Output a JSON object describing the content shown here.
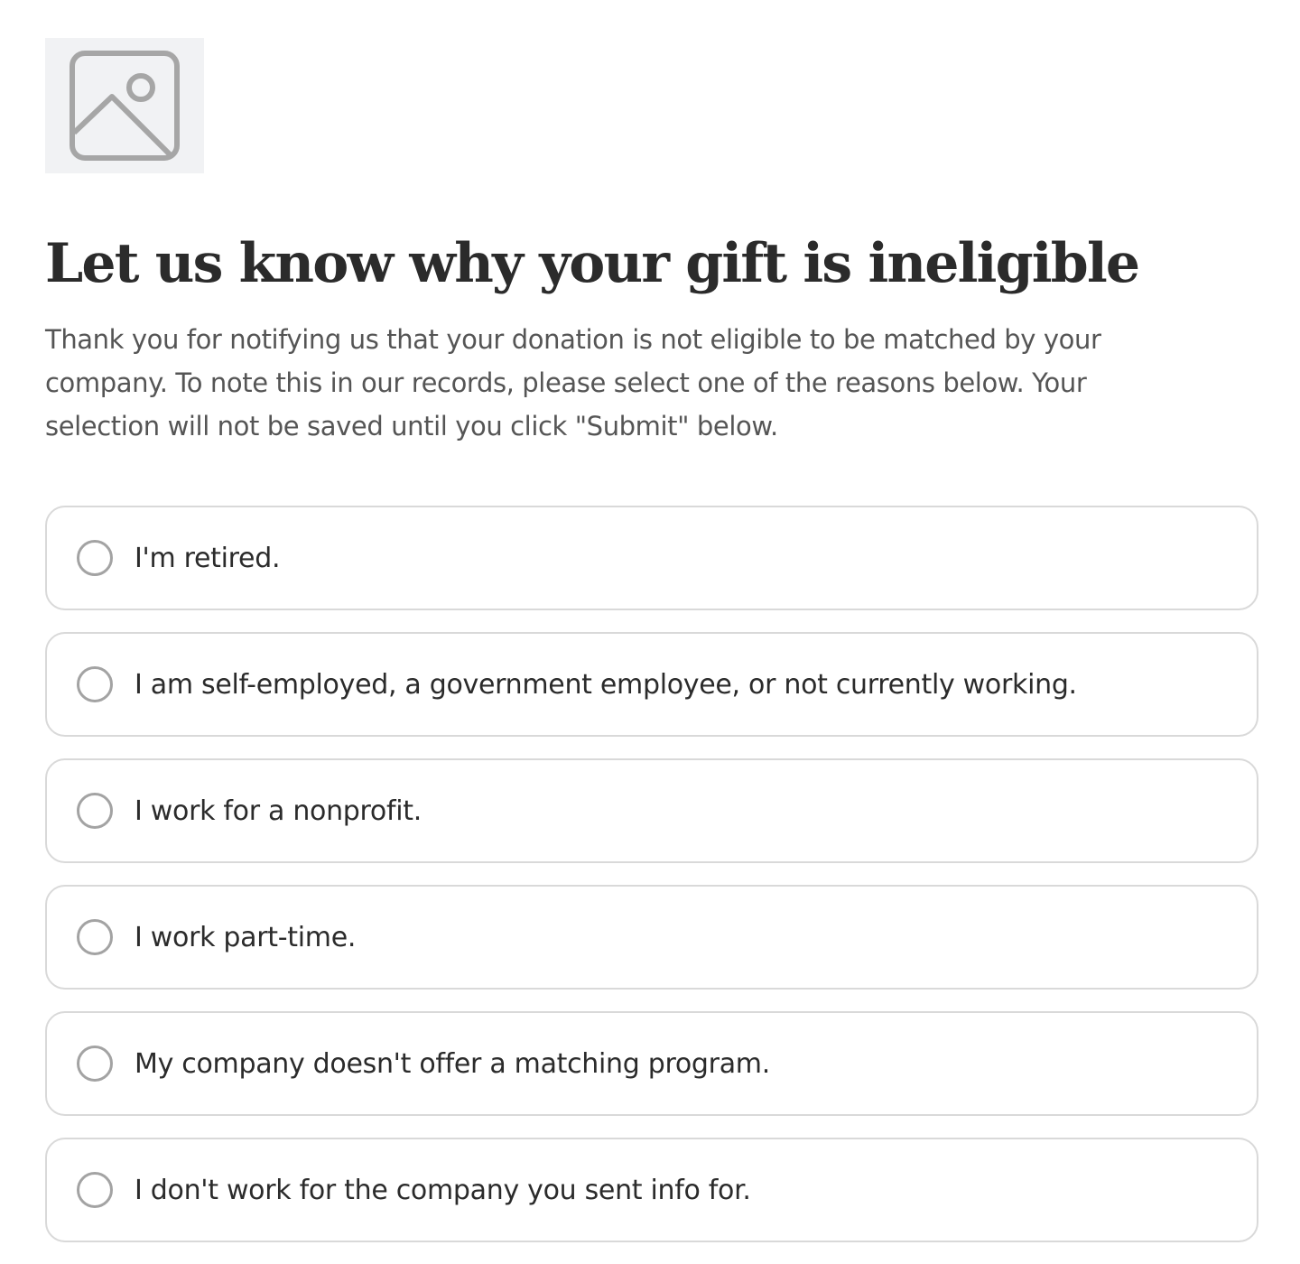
{
  "header": {
    "logo_icon": "image-placeholder-icon",
    "title": "Let us know why your gift is ineligible",
    "intro": "Thank you for notifying us that your donation is not eligible to be matched by your company. To note this in our records, please select one of the reasons below. Your selection will not be saved until you click \"Submit\" below."
  },
  "reasons": [
    {
      "label": "I'm retired.",
      "selected": false
    },
    {
      "label": "I am self-employed, a government employee, or not currently working.",
      "selected": false
    },
    {
      "label": "I work for a nonprofit.",
      "selected": false
    },
    {
      "label": "I work part-time.",
      "selected": false
    },
    {
      "label": "My company doesn't offer a matching program.",
      "selected": false
    },
    {
      "label": "I don't work for the company you sent info for.",
      "selected": false
    }
  ],
  "colors": {
    "title": "#2b2b2b",
    "body_text": "#555555",
    "option_border": "#d9d9d9",
    "radio_border": "#a3a3a3",
    "placeholder_bg": "#f1f2f4"
  }
}
